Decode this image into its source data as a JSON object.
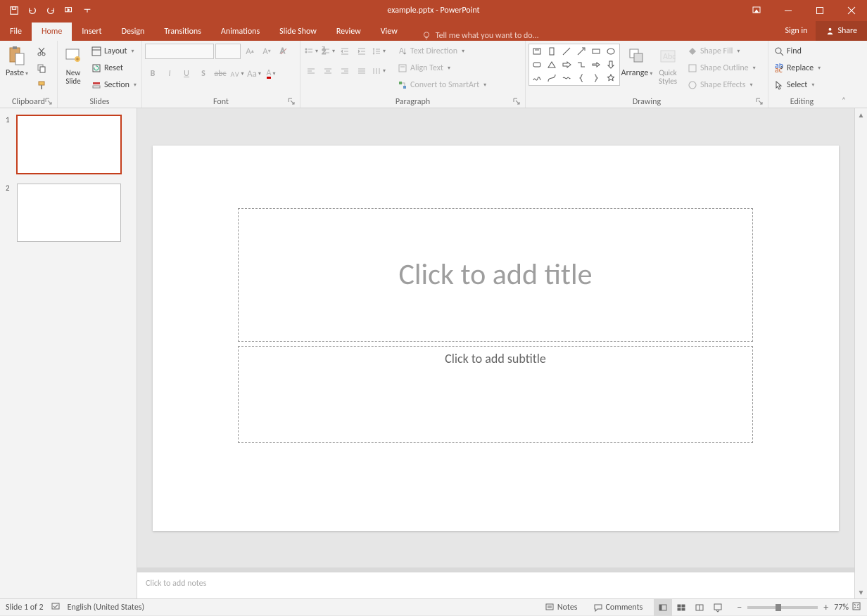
{
  "titlebar": {
    "title": "example.pptx - PowerPoint"
  },
  "tabs": {
    "file": "File",
    "home": "Home",
    "insert": "Insert",
    "design": "Design",
    "transitions": "Transitions",
    "animations": "Animations",
    "slideshow": "Slide Show",
    "review": "Review",
    "view": "View",
    "tell_me": "Tell me what you want to do...",
    "signin": "Sign in",
    "share": "Share"
  },
  "ribbon": {
    "clipboard": {
      "group": "Clipboard",
      "paste": "Paste",
      "cut": "Cut",
      "copy": "Copy",
      "format_painter": "Format Painter"
    },
    "slides": {
      "group": "Slides",
      "new_slide": "New\nSlide",
      "layout": "Layout",
      "reset": "Reset",
      "section": "Section"
    },
    "font": {
      "group": "Font"
    },
    "paragraph": {
      "group": "Paragraph",
      "text_direction": "Text Direction",
      "align_text": "Align Text",
      "convert_smartart": "Convert to SmartArt"
    },
    "drawing": {
      "group": "Drawing",
      "arrange": "Arrange",
      "quick_styles": "Quick\nStyles",
      "shape_fill": "Shape Fill",
      "shape_outline": "Shape Outline",
      "shape_effects": "Shape Effects"
    },
    "editing": {
      "group": "Editing",
      "find": "Find",
      "replace": "Replace",
      "select": "Select"
    }
  },
  "thumbnails": [
    {
      "num": "1",
      "selected": true
    },
    {
      "num": "2",
      "selected": false
    }
  ],
  "slide": {
    "title_placeholder": "Click to add title",
    "subtitle_placeholder": "Click to add subtitle"
  },
  "notes": {
    "placeholder": "Click to add notes"
  },
  "statusbar": {
    "slide_info": "Slide 1 of 2",
    "language": "English (United States)",
    "notes_btn": "Notes",
    "comments_btn": "Comments",
    "zoom_pct": "77%"
  }
}
